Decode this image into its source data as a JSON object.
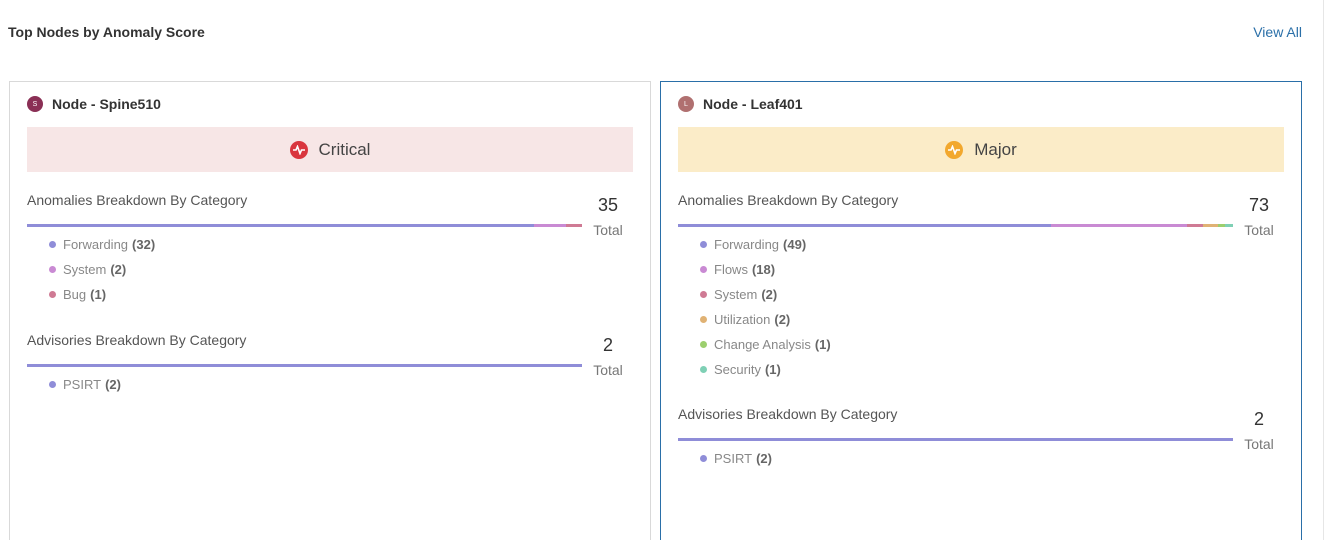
{
  "header": {
    "title": "Top Nodes by Anomaly Score",
    "view_all": "View All"
  },
  "nodes": [
    {
      "avatar_letter": "S",
      "avatar_color": "#8a2f55",
      "label": "Node -  Spine510",
      "severity": "Critical",
      "severity_bg": "#f7e6e6",
      "severity_icon_color": "#d9363e",
      "anomalies": {
        "title": "Anomalies Breakdown By Category",
        "total": "35",
        "total_label": "Total",
        "items": [
          {
            "name": "Forwarding",
            "count": "(32)",
            "value": 32,
            "color": "#8f8dd8"
          },
          {
            "name": "System",
            "count": "(2)",
            "value": 2,
            "color": "#c98ad3"
          },
          {
            "name": "Bug",
            "count": "(1)",
            "value": 1,
            "color": "#cf7a94"
          }
        ]
      },
      "advisories": {
        "title": "Advisories Breakdown By Category",
        "total": "2",
        "total_label": "Total",
        "items": [
          {
            "name": "PSIRT",
            "count": "(2)",
            "value": 2,
            "color": "#8f8dd8"
          }
        ]
      }
    },
    {
      "avatar_letter": "L",
      "avatar_color": "#b07070",
      "label": "Node -  Leaf401",
      "severity": "Major",
      "severity_bg": "#fbecc8",
      "severity_icon_color": "#f2a82e",
      "anomalies": {
        "title": "Anomalies Breakdown By Category",
        "total": "73",
        "total_label": "Total",
        "items": [
          {
            "name": "Forwarding",
            "count": "(49)",
            "value": 49,
            "color": "#8f8dd8"
          },
          {
            "name": "Flows",
            "count": "(18)",
            "value": 18,
            "color": "#c98ad3"
          },
          {
            "name": "System",
            "count": "(2)",
            "value": 2,
            "color": "#cf7a94"
          },
          {
            "name": "Utilization",
            "count": "(2)",
            "value": 2,
            "color": "#e0b274"
          },
          {
            "name": "Change Analysis",
            "count": "(1)",
            "value": 1,
            "color": "#9ccf6e"
          },
          {
            "name": "Security",
            "count": "(1)",
            "value": 1,
            "color": "#7fd0b5"
          }
        ]
      },
      "advisories": {
        "title": "Advisories Breakdown By Category",
        "total": "2",
        "total_label": "Total",
        "items": [
          {
            "name": "PSIRT",
            "count": "(2)",
            "value": 2,
            "color": "#8f8dd8"
          }
        ]
      }
    }
  ]
}
